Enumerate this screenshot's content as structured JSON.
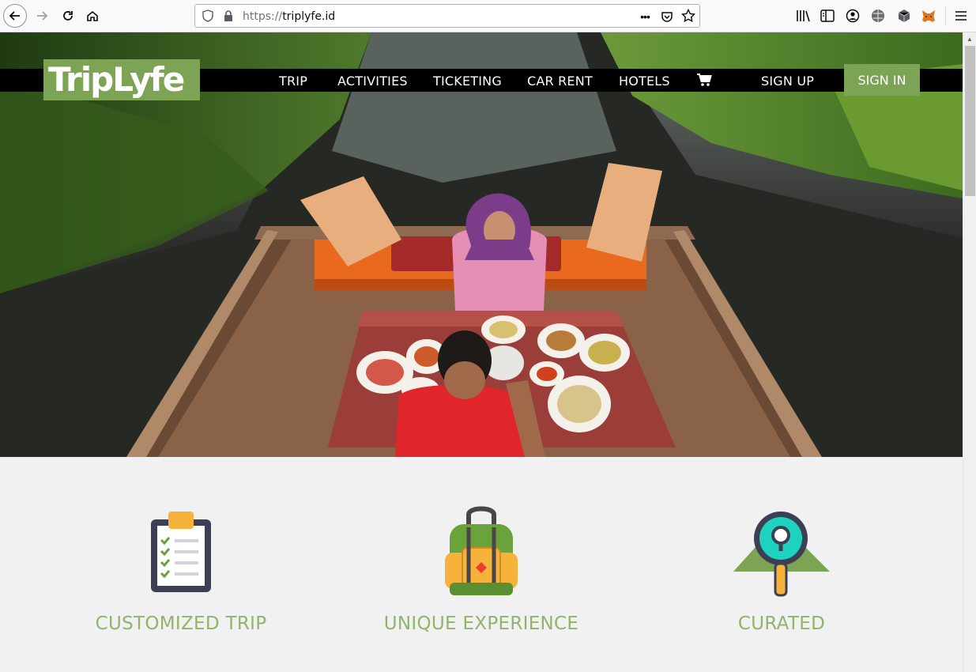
{
  "browser": {
    "url_protocol": "https://",
    "url_host": "triplyfe.id"
  },
  "site": {
    "logo_text": "TripLyfe",
    "menu": [
      "TRIP",
      "ACTIVITIES",
      "TICKETING",
      "CAR RENT",
      "HOTELS"
    ],
    "signup_label": "SIGN UP",
    "signin_label": "SIGN IN"
  },
  "features": [
    {
      "label": "CUSTOMIZED TRIP",
      "icon": "clipboard-checklist-icon"
    },
    {
      "label": "UNIQUE EXPERIENCE",
      "icon": "backpack-icon"
    },
    {
      "label": "CURATED",
      "icon": "magnifier-map-icon"
    }
  ],
  "colors": {
    "brand_green": "#7da354",
    "feature_text": "#90b46a",
    "navbar_bg": "#000000"
  }
}
